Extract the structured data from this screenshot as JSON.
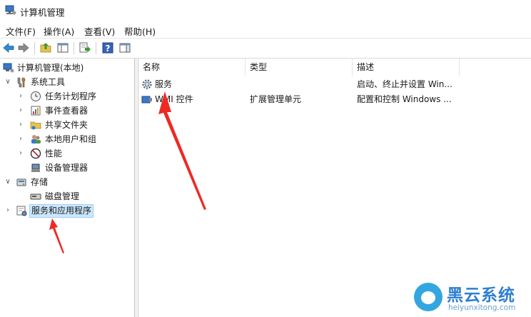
{
  "window": {
    "title": "计算机管理",
    "app_icon": "computer-management-icon"
  },
  "menu": [
    "文件(F)",
    "操作(A)",
    "查看(V)",
    "帮助(H)"
  ],
  "toolbar": [
    {
      "name": "back-icon"
    },
    {
      "name": "forward-icon"
    },
    {
      "name": "up-folder-icon"
    },
    {
      "name": "show-hide-tree-icon"
    },
    {
      "name": "export-list-icon"
    },
    {
      "name": "help-icon"
    },
    {
      "name": "show-hide-action-pane-icon"
    }
  ],
  "tree": {
    "root": "计算机管理(本地)",
    "system_tools": "系统工具",
    "task_scheduler": "任务计划程序",
    "event_viewer": "事件查看器",
    "shared_folders": "共享文件夹",
    "local_users": "本地用户和组",
    "performance": "性能",
    "device_manager": "设备管理器",
    "storage": "存储",
    "disk_management": "磁盘管理",
    "services_apps": "服务和应用程序"
  },
  "list": {
    "columns": [
      "名称",
      "类型",
      "描述"
    ],
    "rows": [
      {
        "name": "服务",
        "type": "",
        "description": "启动、终止并设置 Win..."
      },
      {
        "name": "WMI 控件",
        "type": "扩展管理单元",
        "description": "配置和控制 Windows ..."
      }
    ]
  },
  "watermark": {
    "title": "黑云系统",
    "url": "heiyunxitong.com"
  },
  "colors": {
    "selection": "#cce8ff",
    "arrow": "#ee2a24",
    "watermark": "#2f7fd0"
  }
}
